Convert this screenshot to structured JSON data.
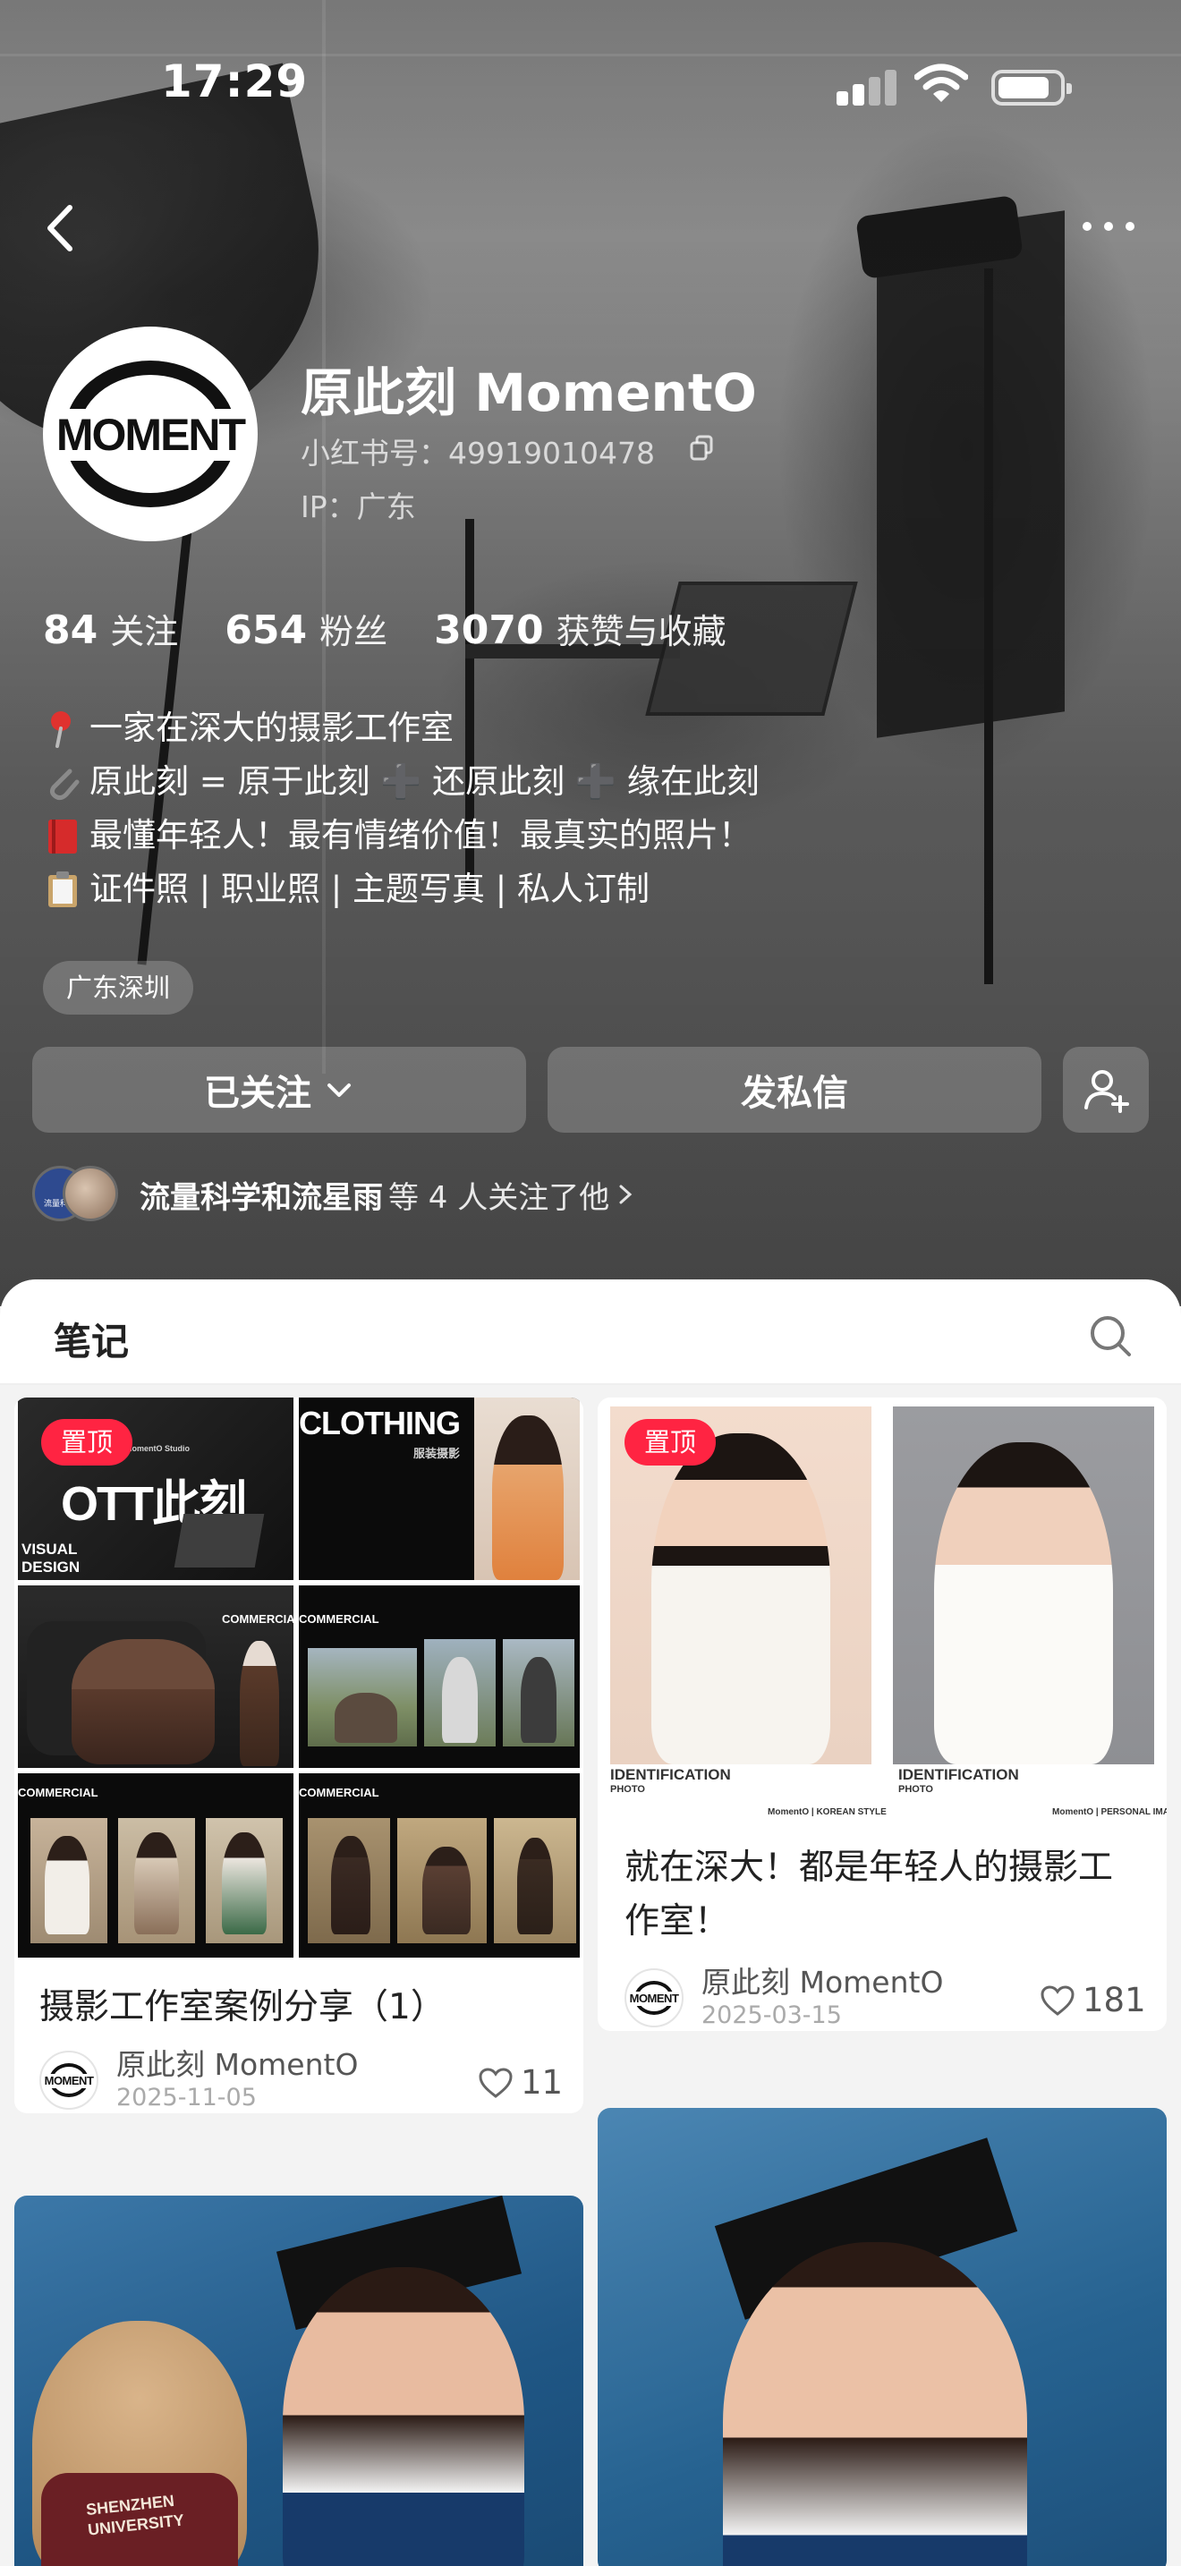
{
  "status_bar": {
    "time": "17:29"
  },
  "profile": {
    "name": "原此刻 MomentO",
    "id_text": "小红书号：49919010478",
    "ip_text": "IP：广东",
    "avatar_text": "MOMENT"
  },
  "stats": [
    {
      "num": "84",
      "label": "关注"
    },
    {
      "num": "654",
      "label": "粉丝"
    },
    {
      "num": "3070",
      "label": "获赞与收藏"
    }
  ],
  "bio": [
    {
      "icon": "pin-icon",
      "text": "一家在深大的摄影工作室"
    },
    {
      "icon": "paperclip-icon",
      "text": "原此刻 = 原于此刻 ➕ 还原此刻 ➕ 缘在此刻"
    },
    {
      "icon": "red-book-icon",
      "text": "最懂年轻人！最有情绪价值！最真实的照片！"
    },
    {
      "icon": "clipboard-icon",
      "text": "证件照 | 职业照 | 主题写真 | 私人订制"
    }
  ],
  "location_tag": "广东深圳",
  "actions": {
    "follow": "已关注",
    "message": "发私信"
  },
  "mutual": {
    "names": "流量科学和流星雨",
    "rest": "等 4 人关注了他",
    "avatar_label": "流量科学"
  },
  "tabs": {
    "notes": "笔记"
  },
  "notes": [
    {
      "pinned": "置顶",
      "title": "摄影工作室案例分享（1）",
      "author": "原此刻 MomentO",
      "date": "2025-11-05",
      "likes": "11",
      "cover_texts": [
        "OTT此刻",
        "VISUAL",
        "DESIGN",
        "CLOTHING",
        "服装摄影",
        "COMMERCIAL",
        "COMMERCIAL",
        "COMMERCIAL",
        "COMMERCIAL",
        "MomentO Studio"
      ]
    },
    {
      "pinned": "置顶",
      "title": "就在深大！都是年轻人的摄影工作室！",
      "author": "原此刻 MomentO",
      "date": "2025-03-15",
      "likes": "181",
      "cover_texts": [
        "IDENTIFICATION",
        "PHOTO",
        "IDENTIFICATION",
        "PHOTO",
        "MomentO | KOREAN STYLE",
        "MomentO | PERSONAL IMAGE"
      ]
    },
    {
      "cover_texts": [
        "SHENZHEN",
        "UNIVERSITY"
      ]
    },
    {
      "cover_texts": []
    }
  ],
  "colors": {
    "accent": "#ff2442",
    "sheet_bg": "#f3f3f3"
  }
}
